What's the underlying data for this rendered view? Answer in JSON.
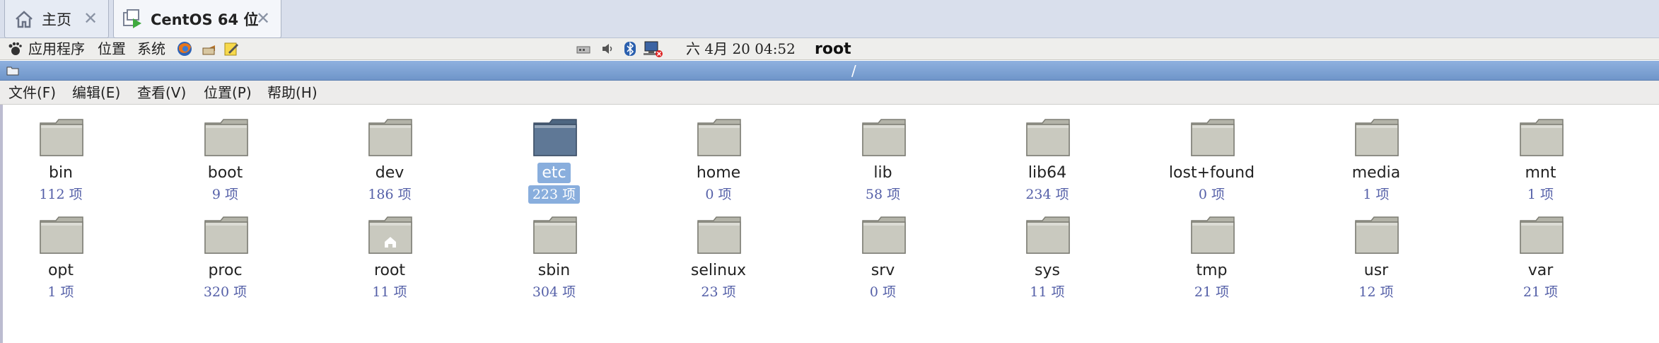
{
  "tabs": [
    {
      "label": "主页",
      "icon": "home-icon"
    },
    {
      "label": "CentOS 64 位",
      "icon": "vm-play-icon"
    }
  ],
  "panel": {
    "menus": [
      "应用程序",
      "位置",
      "系统"
    ],
    "clock": "六 4月 20 04:52",
    "user": "root"
  },
  "location": {
    "path": "/"
  },
  "menubar": {
    "file": "文件(F)",
    "edit": "编辑(E)",
    "view": "查看(V)",
    "places": "位置(P)",
    "help": "帮助(H)"
  },
  "items": [
    {
      "name": "bin",
      "count": "112 项"
    },
    {
      "name": "boot",
      "count": "9 项"
    },
    {
      "name": "dev",
      "count": "186 项"
    },
    {
      "name": "etc",
      "count": "223 项",
      "selected": true
    },
    {
      "name": "home",
      "count": "0 项"
    },
    {
      "name": "lib",
      "count": "58 项"
    },
    {
      "name": "lib64",
      "count": "234 项"
    },
    {
      "name": "lost+found",
      "count": "0 项"
    },
    {
      "name": "media",
      "count": "1 项"
    },
    {
      "name": "mnt",
      "count": "1 项"
    },
    {
      "name": "opt",
      "count": "1 项"
    },
    {
      "name": "proc",
      "count": "320 项"
    },
    {
      "name": "root",
      "count": "11 项",
      "home_badge": true
    },
    {
      "name": "sbin",
      "count": "304 项"
    },
    {
      "name": "selinux",
      "count": "23 项"
    },
    {
      "name": "srv",
      "count": "0 项"
    },
    {
      "name": "sys",
      "count": "11 项"
    },
    {
      "name": "tmp",
      "count": "21 项"
    },
    {
      "name": "usr",
      "count": "12 项"
    },
    {
      "name": "var",
      "count": "21 项"
    }
  ],
  "colors": {
    "folder": "#c9c9bf",
    "folder_selected": "#5f7896",
    "selection": "#89aedd",
    "count_text": "#5560a8",
    "location_bar": "#7fa3d6"
  }
}
